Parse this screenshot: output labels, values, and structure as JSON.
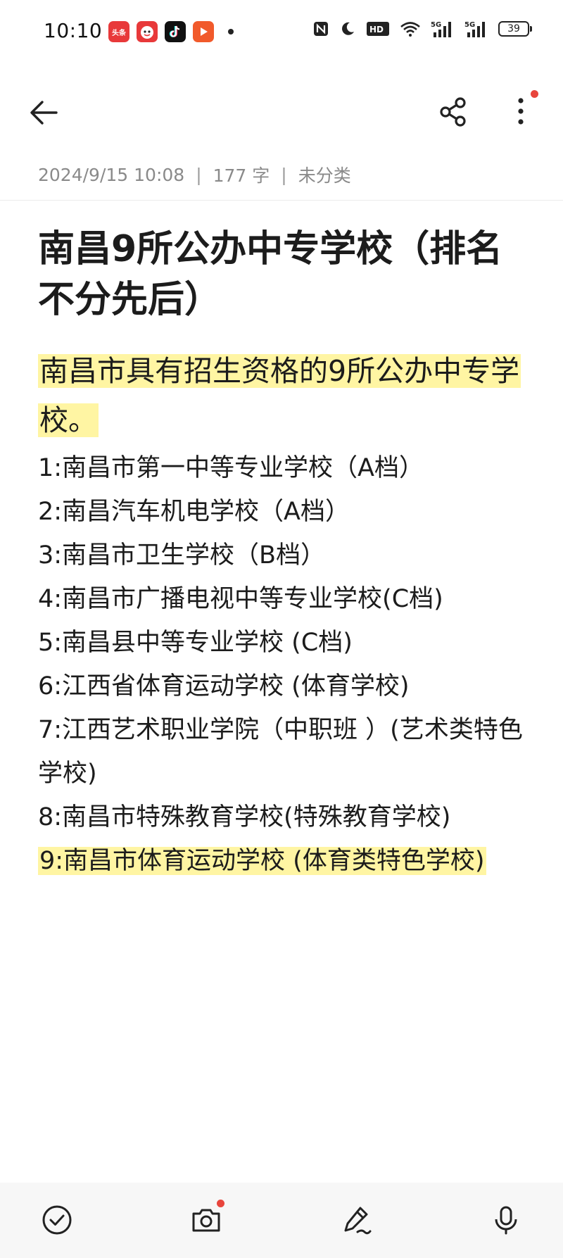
{
  "status_bar": {
    "time": "10:10",
    "notification_apps": [
      "toutiao-icon",
      "mascot-app-icon",
      "tiktok-icon",
      "video-app-icon"
    ],
    "toutiao_label": "头条",
    "network_5g_1": "5G",
    "network_5g_2": "5G",
    "hd_label": "HD",
    "battery_level": "39"
  },
  "toolbar": {
    "back_icon": "arrow-left-icon",
    "share_icon": "share-icon",
    "more_icon": "more-vertical-icon",
    "more_has_notification": true
  },
  "note": {
    "date": "2024/9/15 10:08",
    "word_count": "177 字",
    "category": "未分类",
    "separator": "|",
    "title": "南昌9所公办中专学校（排名不分先后）",
    "subtitle": "南昌市具有招生资格的9所公办中专学校。",
    "schools": [
      "1:南昌市第一中等专业学校（A档）",
      "2:南昌汽车机电学校（A档）",
      "3:南昌市卫生学校（B档）",
      "4:南昌市广播电视中等专业学校(C档)",
      "5:南昌县中等专业学校 (C档)",
      "6:江西省体育运动学校 (体育学校)",
      "7:江西艺术职业学院（中职班 ）(艺术类特色学校)",
      "8:南昌市特殊教育学校(特殊教育学校)",
      "9:南昌市体育运动学校 (体育类特色学校)"
    ]
  },
  "bottom_bar": {
    "items": [
      "checkbox-icon",
      "camera-icon",
      "pen-icon",
      "microphone-icon"
    ],
    "camera_has_notification": true
  },
  "colors": {
    "highlight": "#fff5a3",
    "notification_dot": "#e8453c",
    "meta_text": "#8a8a8a",
    "bottom_bar_bg": "#f7f7f7"
  }
}
